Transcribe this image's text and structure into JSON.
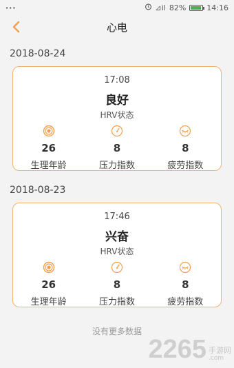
{
  "status_bar": {
    "dots": "···",
    "signal": "⊿il",
    "battery_text": "82%",
    "time": "14:16"
  },
  "nav": {
    "title": "心电"
  },
  "records": [
    {
      "date": "2018-08-24",
      "time": "17:08",
      "state": "良好",
      "state_label": "HRV状态",
      "metrics": [
        {
          "value": "26",
          "label": "生理年龄",
          "icon": "target-icon"
        },
        {
          "value": "8",
          "label": "压力指数",
          "icon": "gauge-icon"
        },
        {
          "value": "8",
          "label": "疲劳指数",
          "icon": "eye-closed-icon"
        }
      ]
    },
    {
      "date": "2018-08-23",
      "time": "17:46",
      "state": "兴奋",
      "state_label": "HRV状态",
      "metrics": [
        {
          "value": "26",
          "label": "生理年龄",
          "icon": "target-icon"
        },
        {
          "value": "8",
          "label": "压力指数",
          "icon": "gauge-icon"
        },
        {
          "value": "8",
          "label": "疲劳指数",
          "icon": "eye-closed-icon"
        }
      ]
    }
  ],
  "footer": {
    "text": "没有更多数据"
  },
  "watermark": {
    "big": "2265",
    "small": "手游网",
    "url": ".com"
  },
  "colors": {
    "accent": "#f0a050",
    "card_border": "#f0b46e",
    "background": "#f3f3f3"
  }
}
